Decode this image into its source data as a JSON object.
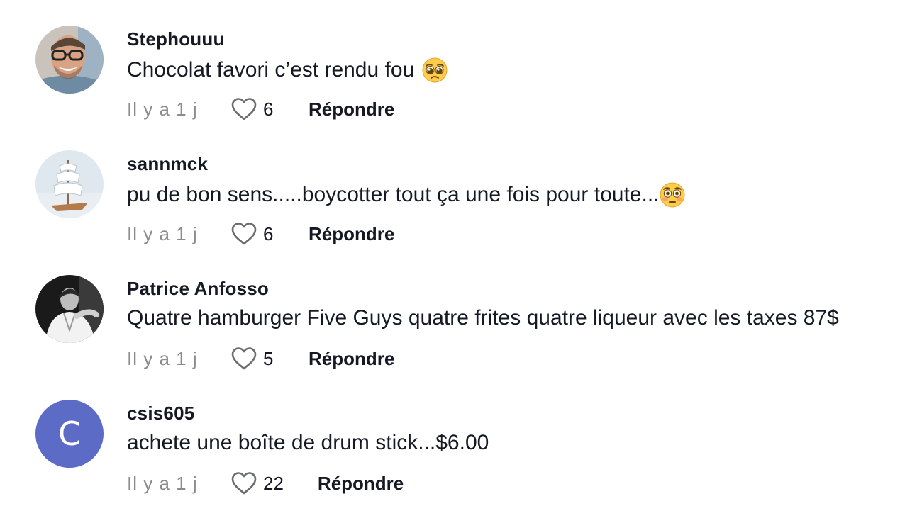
{
  "colors": {
    "text": "#161823",
    "muted": "#8a8b91",
    "avatar_letter_bg": "#5b6bc6"
  },
  "comments": [
    {
      "username": "Stephouuu",
      "text": "Chocolat favori c’est rendu fou",
      "emoji": "pleading-face-emoji",
      "time": "Il y a 1 j",
      "likes": "6",
      "reply": "Répondre",
      "avatar": "photo"
    },
    {
      "username": "sannmck",
      "text": "pu de bon sens.....boycotter tout ça une fois pour toute...",
      "emoji": "flushed-face-emoji",
      "time": "Il y a 1 j",
      "likes": "6",
      "reply": "Répondre",
      "avatar": "sailboat"
    },
    {
      "username": "Patrice Anfosso",
      "text": "Quatre hamburger Five Guys quatre frites quatre liqueur avec les taxes 87$",
      "emoji": "",
      "time": "Il y a 1 j",
      "likes": "5",
      "reply": "Répondre",
      "avatar": "photo-bw"
    },
    {
      "username": "csis605",
      "text": "achete une boîte de drum stick...$6.00",
      "emoji": "",
      "time": "Il y a 1 j",
      "likes": "22",
      "reply": "Répondre",
      "avatar": "letter",
      "avatar_letter": "C"
    }
  ]
}
